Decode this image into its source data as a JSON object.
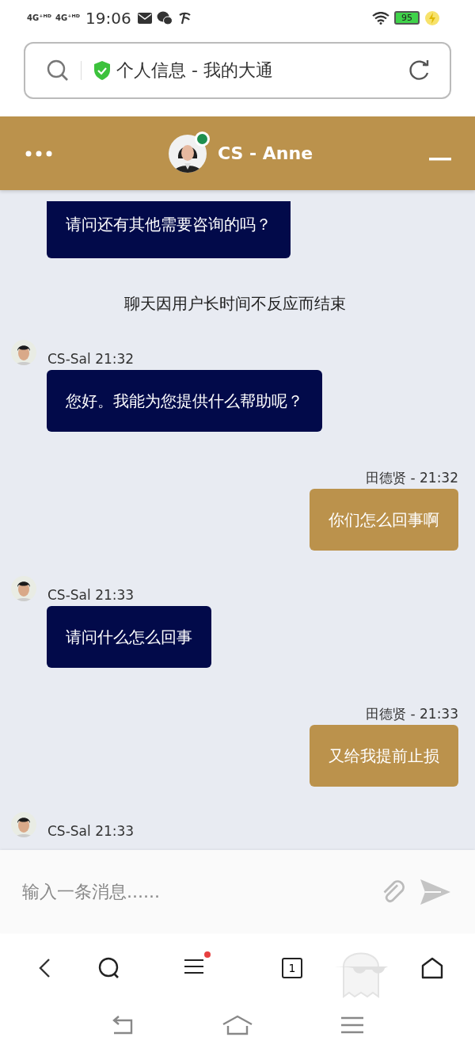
{
  "status_bar": {
    "network_labels": [
      "4G⁺ᴴᴰ",
      "4G⁺ᴴᴰ"
    ],
    "time": "19:06",
    "battery": "95"
  },
  "address_bar": {
    "title": "个人信息 - 我的大通",
    "secure": true
  },
  "chat_header": {
    "title": "CS - Anne",
    "online": true
  },
  "messages": [
    {
      "kind": "agent",
      "text": "请问还有其他需要咨询的吗？"
    },
    {
      "kind": "system",
      "text": "聊天因用户长时间不反应而结束"
    },
    {
      "kind": "agent",
      "meta": "CS-Sal 21:32",
      "text": "您好。我能为您提供什么帮助呢？"
    },
    {
      "kind": "user",
      "meta": "田德贤 - 21:32",
      "text": "你们怎么回事啊"
    },
    {
      "kind": "agent",
      "meta": "CS-Sal 21:33",
      "text": "请问什么怎么回事"
    },
    {
      "kind": "user",
      "meta": "田德贤 - 21:33",
      "text": "又给我提前止损"
    },
    {
      "kind": "agent",
      "meta": "CS-Sal 21:33"
    }
  ],
  "composer": {
    "placeholder": "输入一条消息......"
  },
  "browser_nav": {
    "tab_count": "1",
    "menu_badge": true
  }
}
